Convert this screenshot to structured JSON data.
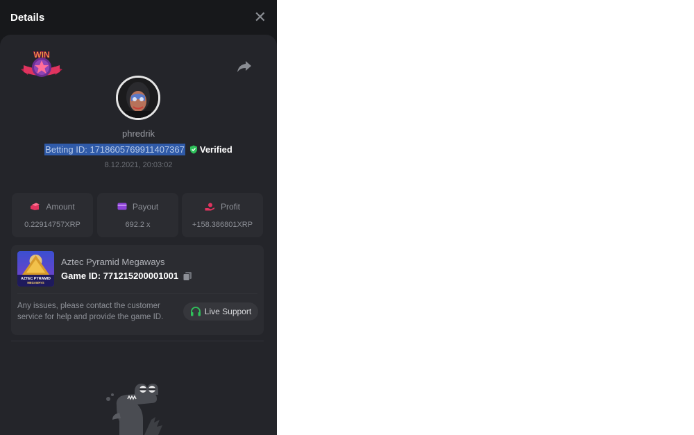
{
  "header": {
    "title": "Details",
    "close_icon": "close-icon"
  },
  "bet": {
    "badge_text": "WIN",
    "username": "phredrik",
    "betting_id": "Betting ID: 1718605769911407367",
    "verified_label": "Verified",
    "timestamp": "8.12.2021, 20:03:02"
  },
  "stats": [
    {
      "label": "Amount",
      "value": "0.22914757XRP",
      "icon": "amount-icon"
    },
    {
      "label": "Payout",
      "value": "692.2 x",
      "icon": "payout-icon"
    },
    {
      "label": "Profit",
      "value": "+158.386801XRP",
      "icon": "profit-icon"
    }
  ],
  "game": {
    "name": "Aztec Pyramid Megaways",
    "game_id": "Game ID: 771215200001001",
    "thumb_line1": "AZTEC PYRAMID",
    "thumb_line2": "MEGAWAYS",
    "support_text": "Any issues, please contact the customer service for help and provide the game ID.",
    "live_support_label": "Live Support"
  },
  "colors": {
    "panel_bg": "#17181b",
    "card_bg": "#24252a",
    "tile_bg": "#2b2c31",
    "verified_green": "#2fc25b",
    "selection_blue": "#2f5aa8",
    "accent_pink": "#e0345f"
  }
}
